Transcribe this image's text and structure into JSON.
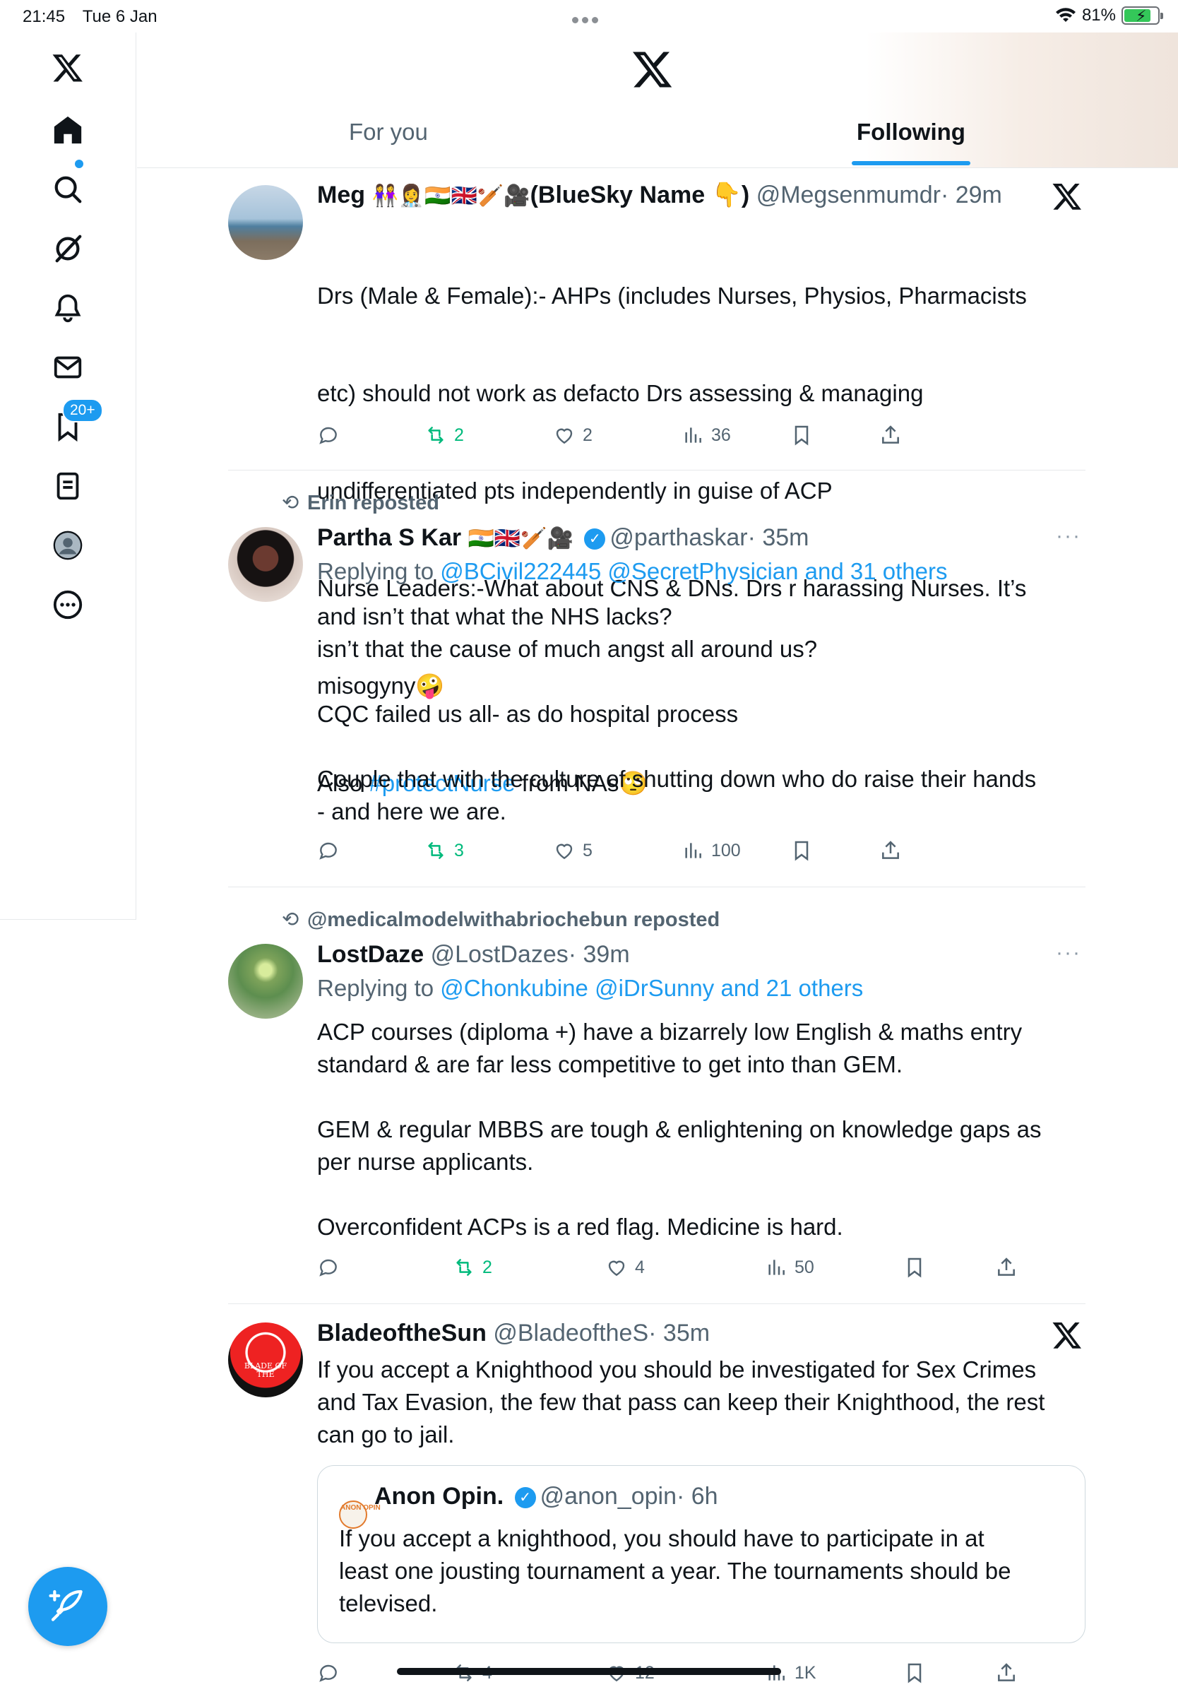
{
  "status_bar": {
    "time": "21:45",
    "date": "Tue 6 Jan",
    "battery": "81%",
    "battery_level": 0.81
  },
  "sidebar": {
    "items": [
      {
        "name": "home-icon",
        "active": true
      },
      {
        "name": "search-icon"
      },
      {
        "name": "grok-icon"
      },
      {
        "name": "notifications-icon",
        "badge": "20+"
      },
      {
        "name": "messages-icon"
      },
      {
        "name": "bookmarks-icon"
      },
      {
        "name": "lists-icon"
      },
      {
        "name": "profile-icon"
      },
      {
        "name": "more-icon"
      }
    ],
    "compose_icon": "compose-feather-icon"
  },
  "header": {
    "logo": "x-logo-icon",
    "tabs": [
      {
        "label": "For you",
        "active": false
      },
      {
        "label": "Following",
        "active": true
      }
    ]
  },
  "tweets": [
    {
      "name": "Meg",
      "name_emoji": "👭👩‍⚕️🇮🇳🇬🇧🏏🎥",
      "name_suffix": "(BlueSky Name 👇)",
      "handle": "@Megsenmumdr",
      "time": "· 29m",
      "body_lines": [
        "Drs (Male & Female):- AHPs (includes Nurses, Physios, Pharmacists",
        "etc) should not work as defacto Drs assessing & managing",
        "undifferentiated pts independently in guise of ACP",
        "Nurse Leaders:-What about CNS & DNs. Drs r harassing Nurses. It’s",
        "misogyny🤪"
      ],
      "body_last_prefix": "Also ",
      "body_last_link": "#protectNurse",
      "body_last_suffix": " from NAs🙄",
      "replies": "",
      "reposts": "2",
      "likes": "2",
      "views": "36"
    },
    {
      "repost_by": "Erin reposted",
      "name": "Partha S Kar",
      "name_emoji": "🇮🇳🇬🇧🏏🎥",
      "handle": "@parthaskar",
      "time": "· 35m",
      "reply_prefix": "Replying to ",
      "reply_to": "@BCivil222445 @SecretPhysician and 31 others",
      "body": "and isn’t that what the NHS lacks?\nisn’t that the cause of much angst all around us?\n\nCQC failed us all- as do hospital process\n\nCouple that with the culture of shutting down who do raise their hands\n- and here we are.",
      "replies": "",
      "reposts": "3",
      "likes": "5",
      "views": "100"
    },
    {
      "repost_by": "@medicalmodelwithabriochebun reposted",
      "name": "LostDaze",
      "handle": "@LostDazes",
      "time": "· 39m",
      "reply_prefix": "Replying to ",
      "reply_to": "@Chonkubine @iDrSunny and 21 others",
      "body": "ACP courses (diploma +) have a bizarrely low English & maths entry\nstandard & are far less competitive to get into than GEM.\n\nGEM & regular MBBS are tough & enlightening on knowledge gaps as\nper nurse applicants.\n\nOverconfident ACPs is a red flag. Medicine is hard.",
      "replies": "",
      "reposts": "2",
      "likes": "4",
      "views": "50"
    },
    {
      "name": "BladeoftheSun",
      "handle": "@BladeoftheS",
      "time": "· 35m",
      "body": "If you accept a Knighthood you should be investigated for Sex Crimes\nand Tax Evasion, the few that pass can keep their Knighthood, the rest\ncan go to jail.",
      "avatar_text": "BLADE OF THE",
      "quote": {
        "avatar_text": "ANON OPIN",
        "name": "Anon Opin.",
        "handle": "@anon_opin",
        "time": "· 6h",
        "body": "If you accept a knighthood, you should have to participate in at\nleast one jousting tournament a year. The tournaments should be\ntelevised."
      },
      "replies": "",
      "reposts": "4",
      "likes": "12",
      "views": "1K"
    }
  ],
  "colors": {
    "accent": "#1d9bf0",
    "repost_green": "#00ba7c",
    "muted": "#536471",
    "text": "#0f1419"
  }
}
